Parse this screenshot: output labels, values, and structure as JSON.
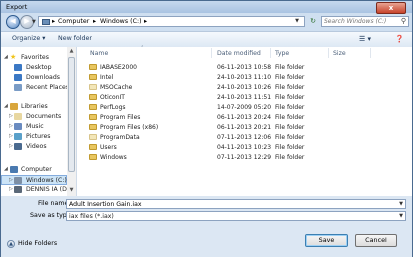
{
  "window": {
    "title": "Export",
    "close_glyph": "x"
  },
  "address": {
    "crumbs": [
      "Computer",
      "Windows (C:)"
    ],
    "search_placeholder": "Search Windows (C:)"
  },
  "toolbar": {
    "organize": "Organize",
    "new_folder": "New folder"
  },
  "nav": [
    {
      "label": "Favorites",
      "icon": "star-icon",
      "color": "#f0c419"
    },
    {
      "label": "Desktop",
      "icon": "desktop-icon",
      "color": "#3b78c4"
    },
    {
      "label": "Downloads",
      "icon": "downloads-icon",
      "color": "#3b78c4"
    },
    {
      "label": "Recent Places",
      "icon": "recent-places-icon",
      "color": "#7a9cc6"
    },
    {
      "label": "Libraries",
      "icon": "libraries-icon",
      "color": "#d9a63c"
    },
    {
      "label": "Documents",
      "icon": "documents-icon",
      "color": "#e8d7a0"
    },
    {
      "label": "Music",
      "icon": "music-icon",
      "color": "#6a8bc0"
    },
    {
      "label": "Pictures",
      "icon": "pictures-icon",
      "color": "#5aa0c9"
    },
    {
      "label": "Videos",
      "icon": "videos-icon",
      "color": "#4a6a8f"
    },
    {
      "label": "Computer",
      "icon": "computer-icon",
      "color": "#4a7ab0"
    },
    {
      "label": "Windows (C:)",
      "icon": "drive-icon",
      "color": "#7d8fa5"
    },
    {
      "label": "DENNIS IA (D:)",
      "icon": "drive-icon",
      "color": "#5a6878"
    }
  ],
  "columns": {
    "name": "Name",
    "date": "Date modified",
    "type": "Type",
    "size": "Size"
  },
  "files": [
    {
      "name": "IABASE2000",
      "date": "06-11-2013 10:58",
      "type": "File folder"
    },
    {
      "name": "Intel",
      "date": "24-10-2013 11:10",
      "type": "File folder"
    },
    {
      "name": "MSOCache",
      "date": "24-10-2013 10:26",
      "type": "File folder",
      "hidden": true
    },
    {
      "name": "OticonIT",
      "date": "24-10-2013 11:51",
      "type": "File folder"
    },
    {
      "name": "PerfLogs",
      "date": "14-07-2009 05:20",
      "type": "File folder"
    },
    {
      "name": "Program Files",
      "date": "06-11-2013 20:24",
      "type": "File folder"
    },
    {
      "name": "Program Files (x86)",
      "date": "06-11-2013 20:21",
      "type": "File folder"
    },
    {
      "name": "ProgramData",
      "date": "07-11-2013 12:06",
      "type": "File folder",
      "hidden": true
    },
    {
      "name": "Users",
      "date": "04-11-2013 10:23",
      "type": "File folder"
    },
    {
      "name": "Windows",
      "date": "07-11-2013 12:29",
      "type": "File folder"
    }
  ],
  "form": {
    "file_name_label": "File name:",
    "file_name_value": "Adult Insertion Gain.iax",
    "save_type_label": "Save as type:",
    "save_type_value": "iax files (*.iax)",
    "hide_folders": "Hide Folders",
    "save": "Save",
    "cancel": "Cancel"
  }
}
